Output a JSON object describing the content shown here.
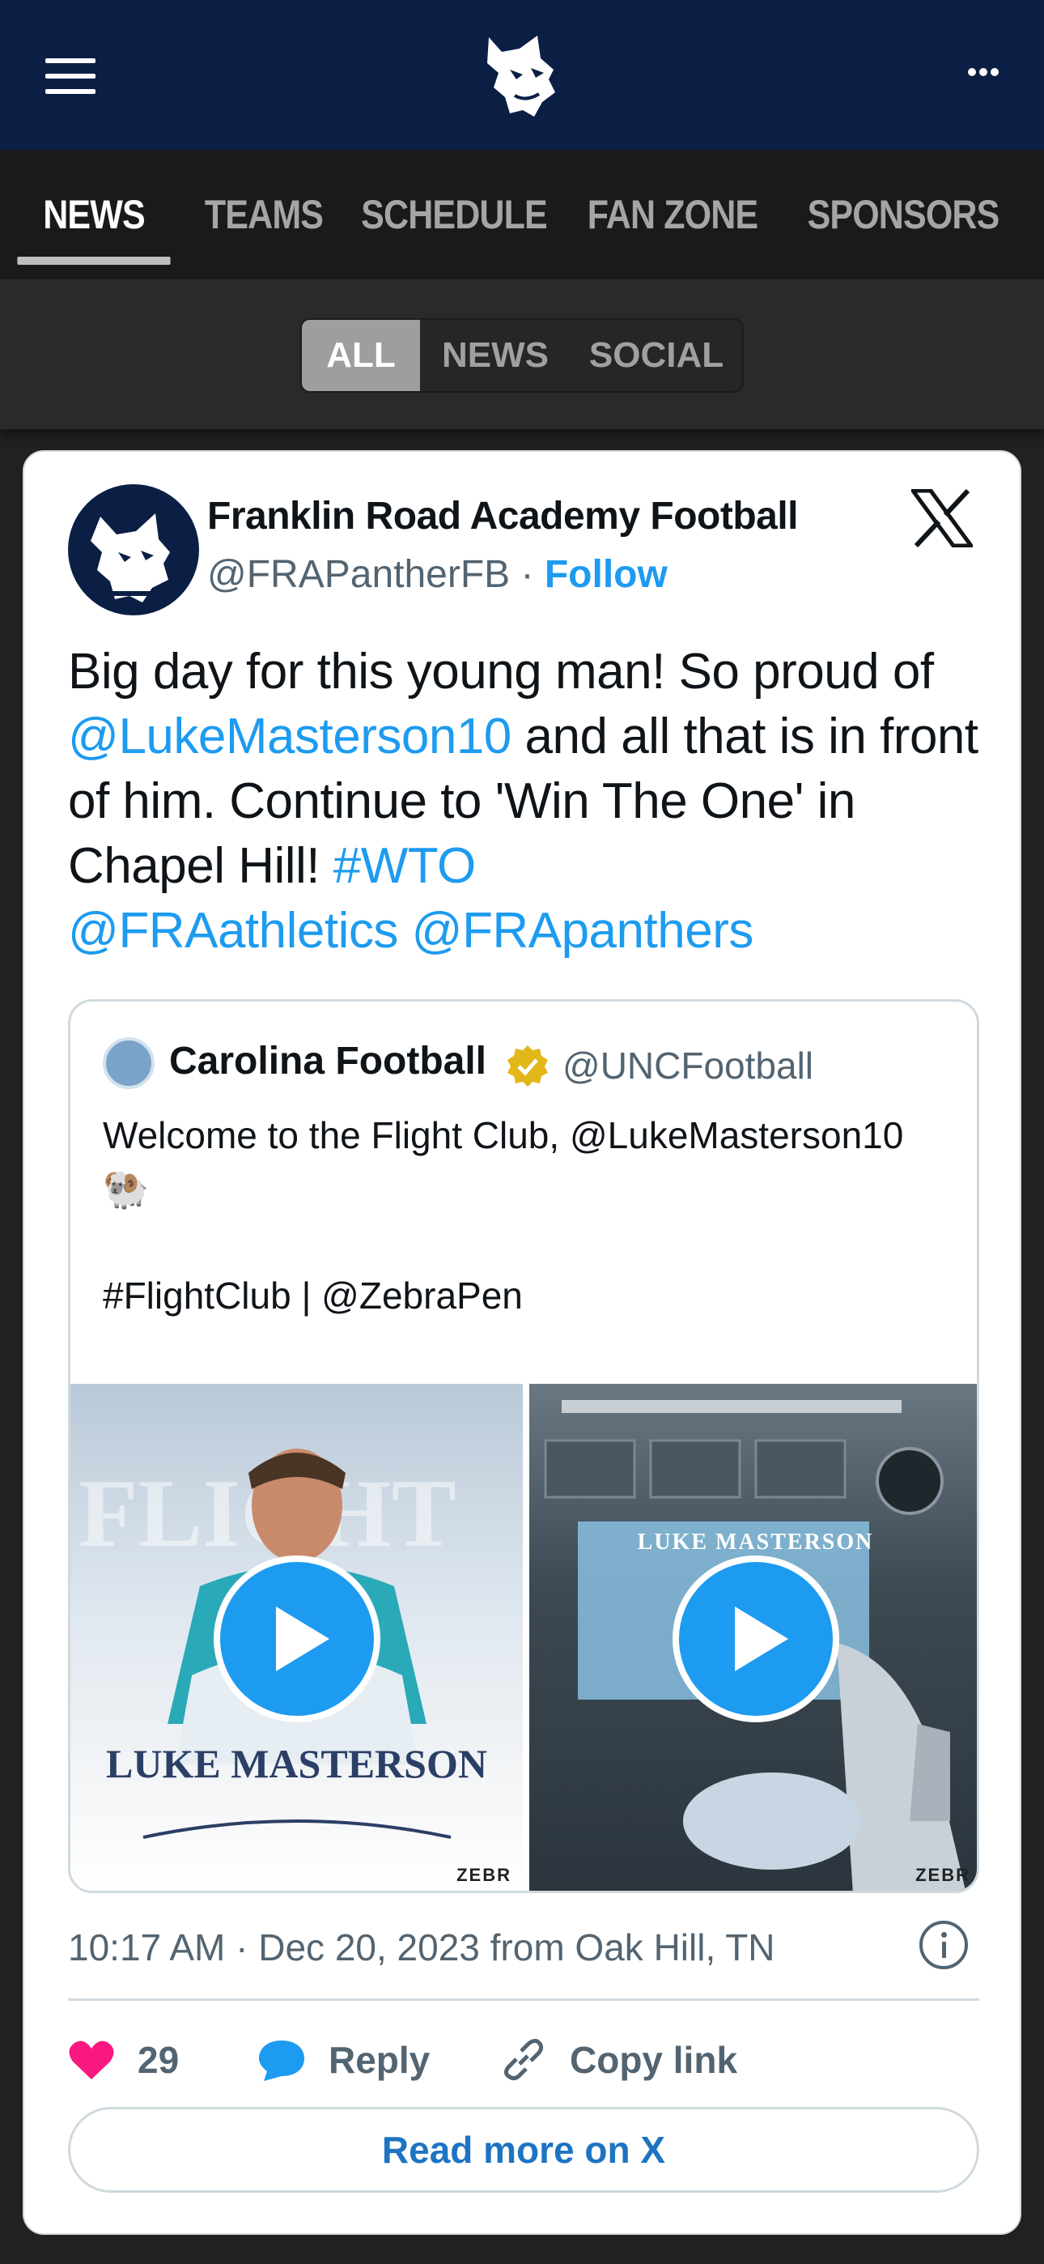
{
  "header": {
    "menu_icon": "hamburger-menu-icon",
    "logo": "panther-logo",
    "more_icon": "more-dots-icon"
  },
  "nav": {
    "tabs": [
      {
        "label": "NEWS",
        "active": true
      },
      {
        "label": "TEAMS",
        "active": false
      },
      {
        "label": "SCHEDULE",
        "active": false
      },
      {
        "label": "FAN ZONE",
        "active": false
      },
      {
        "label": "SPONSORS",
        "active": false
      }
    ]
  },
  "filter": {
    "options": [
      {
        "label": "ALL",
        "active": true
      },
      {
        "label": "NEWS",
        "active": false
      },
      {
        "label": "SOCIAL",
        "active": false
      }
    ]
  },
  "tweet": {
    "author_name": "Franklin Road Academy Football",
    "author_handle": "@FRAPantherFB",
    "separator": " · ",
    "follow_label": "Follow",
    "text": {
      "p1": "Big day for this young man!  So proud of ",
      "mention1": "@LukeMasterson10",
      "p2": " and all that is in front of him.  Continue to 'Win The One' in Chapel Hill!  ",
      "hashtag": "#WTO",
      "mention2": "@FRAathletics",
      "mention3": "@FRApanthers"
    },
    "quote": {
      "name": "Carolina Football",
      "handle": "@UNCFootball",
      "text": "Welcome to the Flight Club, @LukeMasterson10 🐏\n\n#FlightClub | @ZebraPen",
      "media": [
        {
          "caption": "LUKE MASTERSON",
          "watermark": "ZEBR"
        },
        {
          "caption": "LUKE MASTERSON",
          "watermark": "ZEBR"
        }
      ]
    },
    "meta": "10:17 AM · Dec 20, 2023 from Oak Hill, TN",
    "likes": "29",
    "reply_label": "Reply",
    "copy_label": "Copy link",
    "read_more_label": "Read more on X",
    "colors": {
      "link": "#1d9bf0",
      "like": "#f91880",
      "header_bg": "#0b1f45"
    }
  }
}
